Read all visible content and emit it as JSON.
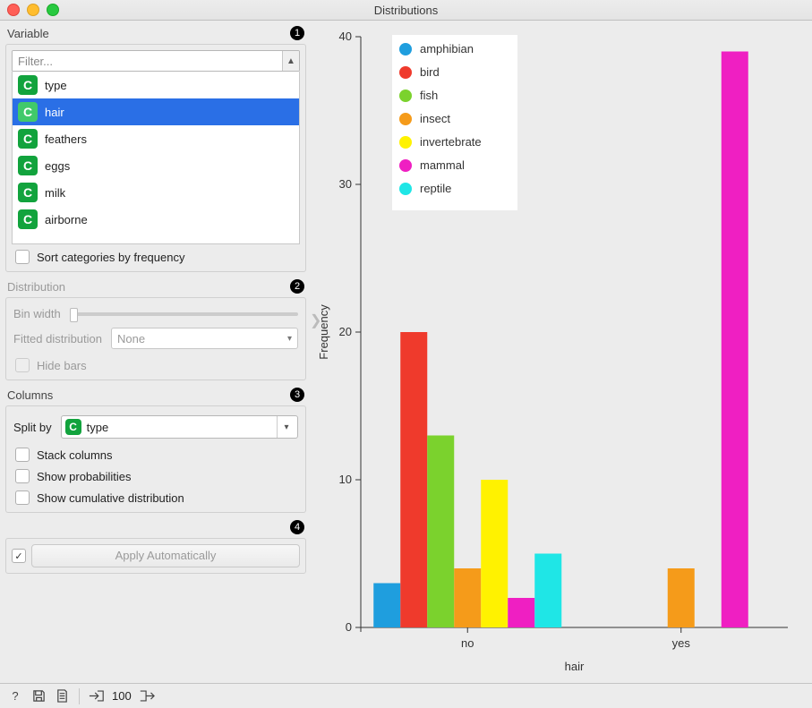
{
  "window": {
    "title": "Distributions"
  },
  "sidebar": {
    "variable": {
      "label": "Variable",
      "badge": "1",
      "filter_placeholder": "Filter...",
      "items": [
        {
          "icon": "C",
          "label": "type",
          "selected": false
        },
        {
          "icon": "C",
          "label": "hair",
          "selected": true
        },
        {
          "icon": "C",
          "label": "feathers",
          "selected": false
        },
        {
          "icon": "C",
          "label": "eggs",
          "selected": false
        },
        {
          "icon": "C",
          "label": "milk",
          "selected": false
        },
        {
          "icon": "C",
          "label": "airborne",
          "selected": false
        }
      ],
      "sort_label": "Sort categories by frequency",
      "sort_checked": false
    },
    "distribution": {
      "label": "Distribution",
      "badge": "2",
      "bin_label": "Bin width",
      "fitted_label": "Fitted distribution",
      "fitted_value": "None",
      "hide_label": "Hide bars"
    },
    "columns": {
      "label": "Columns",
      "badge": "3",
      "split_label": "Split by",
      "split_value": "type",
      "stack_label": "Stack columns",
      "prob_label": "Show probabilities",
      "cum_label": "Show cumulative distribution"
    },
    "apply": {
      "badge": "4",
      "button": "Apply Automatically",
      "auto_checked": true
    }
  },
  "statusbar": {
    "count": "100"
  },
  "colors": {
    "amphibian": "#1f9ede",
    "bird": "#ef3a2c",
    "fish": "#7bd22d",
    "insect": "#f59b1a",
    "invertebrate": "#fff200",
    "mammal": "#ef1fc2",
    "reptile": "#1fe6e6"
  },
  "chart_data": {
    "type": "bar",
    "title": "",
    "xlabel": "hair",
    "ylabel": "Frequency",
    "ylim": [
      0,
      40
    ],
    "categories": [
      "no",
      "yes"
    ],
    "legend": [
      "amphibian",
      "bird",
      "fish",
      "insect",
      "invertebrate",
      "mammal",
      "reptile"
    ],
    "legend_position": "inside-top",
    "series": [
      {
        "name": "amphibian",
        "values": [
          3,
          0
        ]
      },
      {
        "name": "bird",
        "values": [
          20,
          0
        ]
      },
      {
        "name": "fish",
        "values": [
          13,
          0
        ]
      },
      {
        "name": "insect",
        "values": [
          4,
          4
        ]
      },
      {
        "name": "invertebrate",
        "values": [
          10,
          0
        ]
      },
      {
        "name": "mammal",
        "values": [
          2,
          39
        ]
      },
      {
        "name": "reptile",
        "values": [
          5,
          0
        ]
      }
    ]
  }
}
